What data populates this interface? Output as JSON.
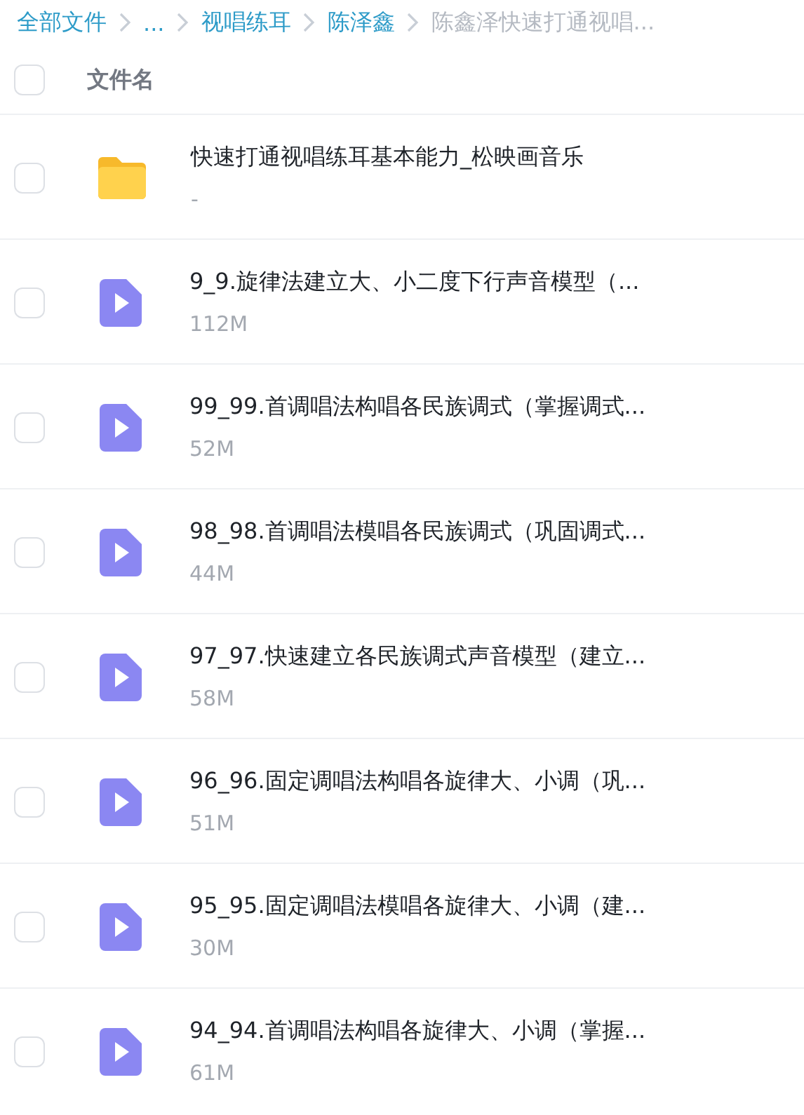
{
  "breadcrumb": [
    {
      "label": "全部文件",
      "current": false
    },
    {
      "label": "...",
      "current": false
    },
    {
      "label": "视唱练耳",
      "current": false
    },
    {
      "label": "陈泽鑫",
      "current": false
    },
    {
      "label": "陈鑫泽快速打通视唱...",
      "current": true
    }
  ],
  "header": {
    "label": "文件名",
    "checked": false
  },
  "files": [
    {
      "kind": "folder",
      "name": "快速打通视唱练耳基本能力_松映画音乐",
      "size": "-",
      "checked": false
    },
    {
      "kind": "video",
      "name": "9_9.旋律法建立大、小二度下行声音模型（...",
      "size": "112M",
      "checked": false
    },
    {
      "kind": "video",
      "name": "99_99.首调唱法构唱各民族调式（掌握调式...",
      "size": "52M",
      "checked": false
    },
    {
      "kind": "video",
      "name": "98_98.首调唱法模唱各民族调式（巩固调式...",
      "size": "44M",
      "checked": false
    },
    {
      "kind": "video",
      "name": "97_97.快速建立各民族调式声音模型（建立...",
      "size": "58M",
      "checked": false
    },
    {
      "kind": "video",
      "name": "96_96.固定调唱法构唱各旋律大、小调（巩...",
      "size": "51M",
      "checked": false
    },
    {
      "kind": "video",
      "name": "95_95.固定调唱法模唱各旋律大、小调（建...",
      "size": "30M",
      "checked": false
    },
    {
      "kind": "video",
      "name": "94_94.首调唱法构唱各旋律大、小调（掌握...",
      "size": "61M",
      "checked": false
    }
  ]
}
